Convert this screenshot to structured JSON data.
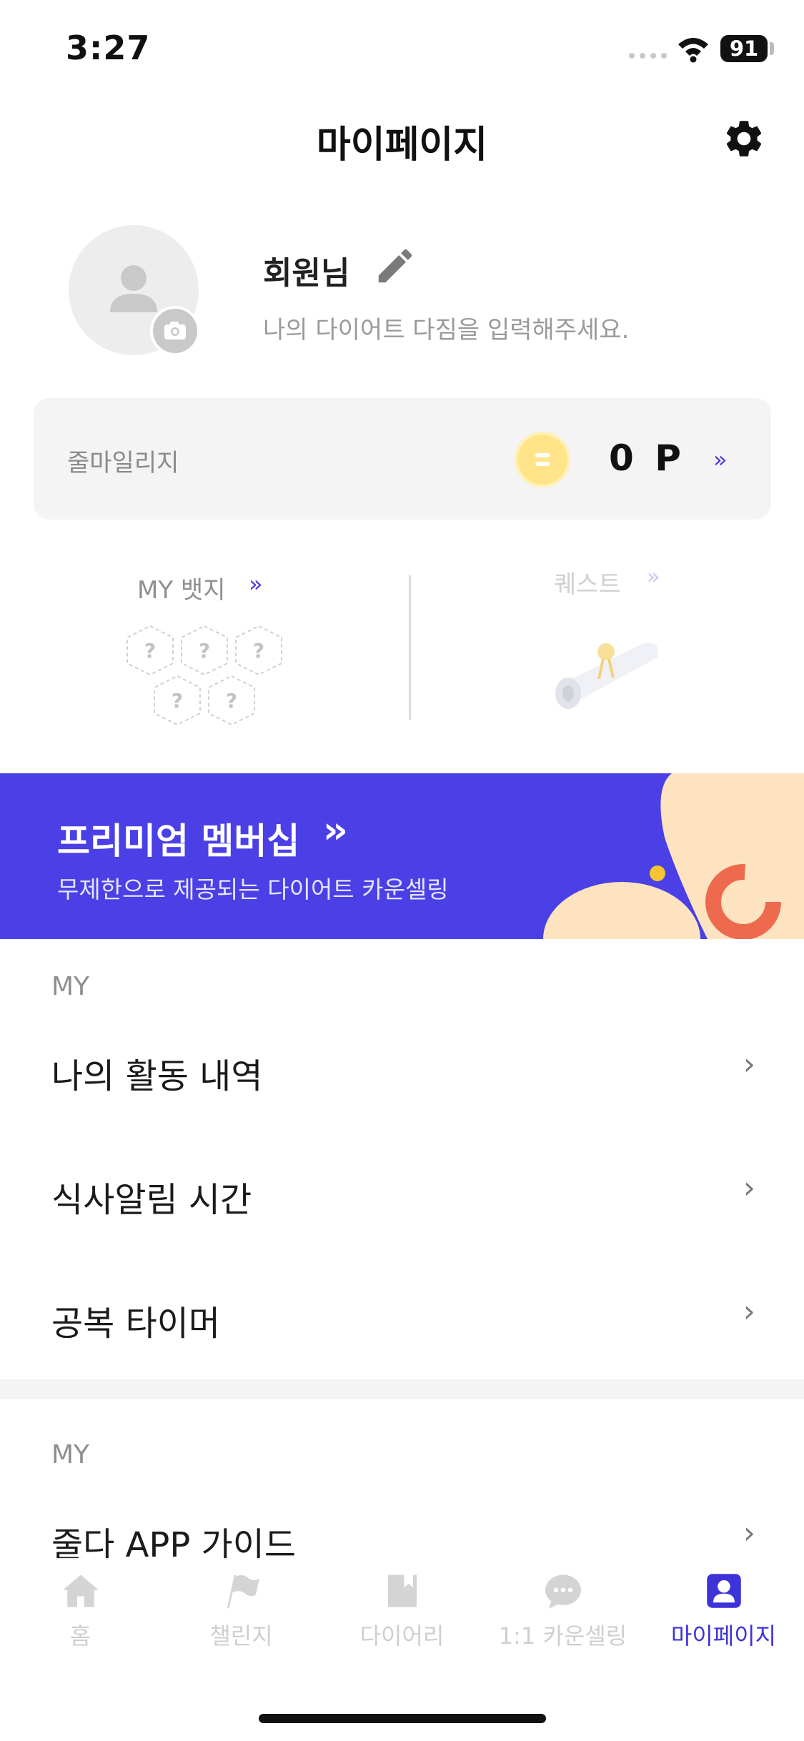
{
  "status_bar": {
    "time": "3:27",
    "battery": "91"
  },
  "header": {
    "title": "마이페이지",
    "settings_icon": "gear-icon"
  },
  "profile": {
    "name": "회원님",
    "motto_placeholder": "나의 다이어트 다짐을 입력해주세요."
  },
  "mileage": {
    "label": "줄마일리지",
    "value": "0 P",
    "arrow": "»"
  },
  "badges": {
    "label": "MY 뱃지",
    "arrow": "»",
    "slots": [
      "?",
      "?",
      "?",
      "?",
      "?"
    ]
  },
  "quest": {
    "label": "퀘스트",
    "arrow": "»"
  },
  "premium": {
    "title": "프리미엄 멤버십",
    "arrows": "››",
    "subtitle": "무제한으로 제공되는 다이어트 카운셀링"
  },
  "section1": {
    "label": "MY",
    "items": [
      {
        "label": "나의 활동 내역"
      },
      {
        "label": "식사알림 시간"
      },
      {
        "label": "공복 타이머"
      }
    ]
  },
  "section2": {
    "label": "MY",
    "items": [
      {
        "label": "줄다 APP 가이드"
      }
    ]
  },
  "chevron": "›",
  "tabs": [
    {
      "label": "홈",
      "icon": "home-icon"
    },
    {
      "label": "챌린지",
      "icon": "flag-icon"
    },
    {
      "label": "다이어리",
      "icon": "book-icon"
    },
    {
      "label": "1:1 카운셀링",
      "icon": "chat-icon"
    },
    {
      "label": "마이페이지",
      "icon": "user-icon",
      "active": true
    }
  ],
  "colors": {
    "accent": "#4a40e6",
    "banner_shape": "#fde3bf",
    "ring": "#ee6a4f",
    "dot": "#f6c431"
  }
}
